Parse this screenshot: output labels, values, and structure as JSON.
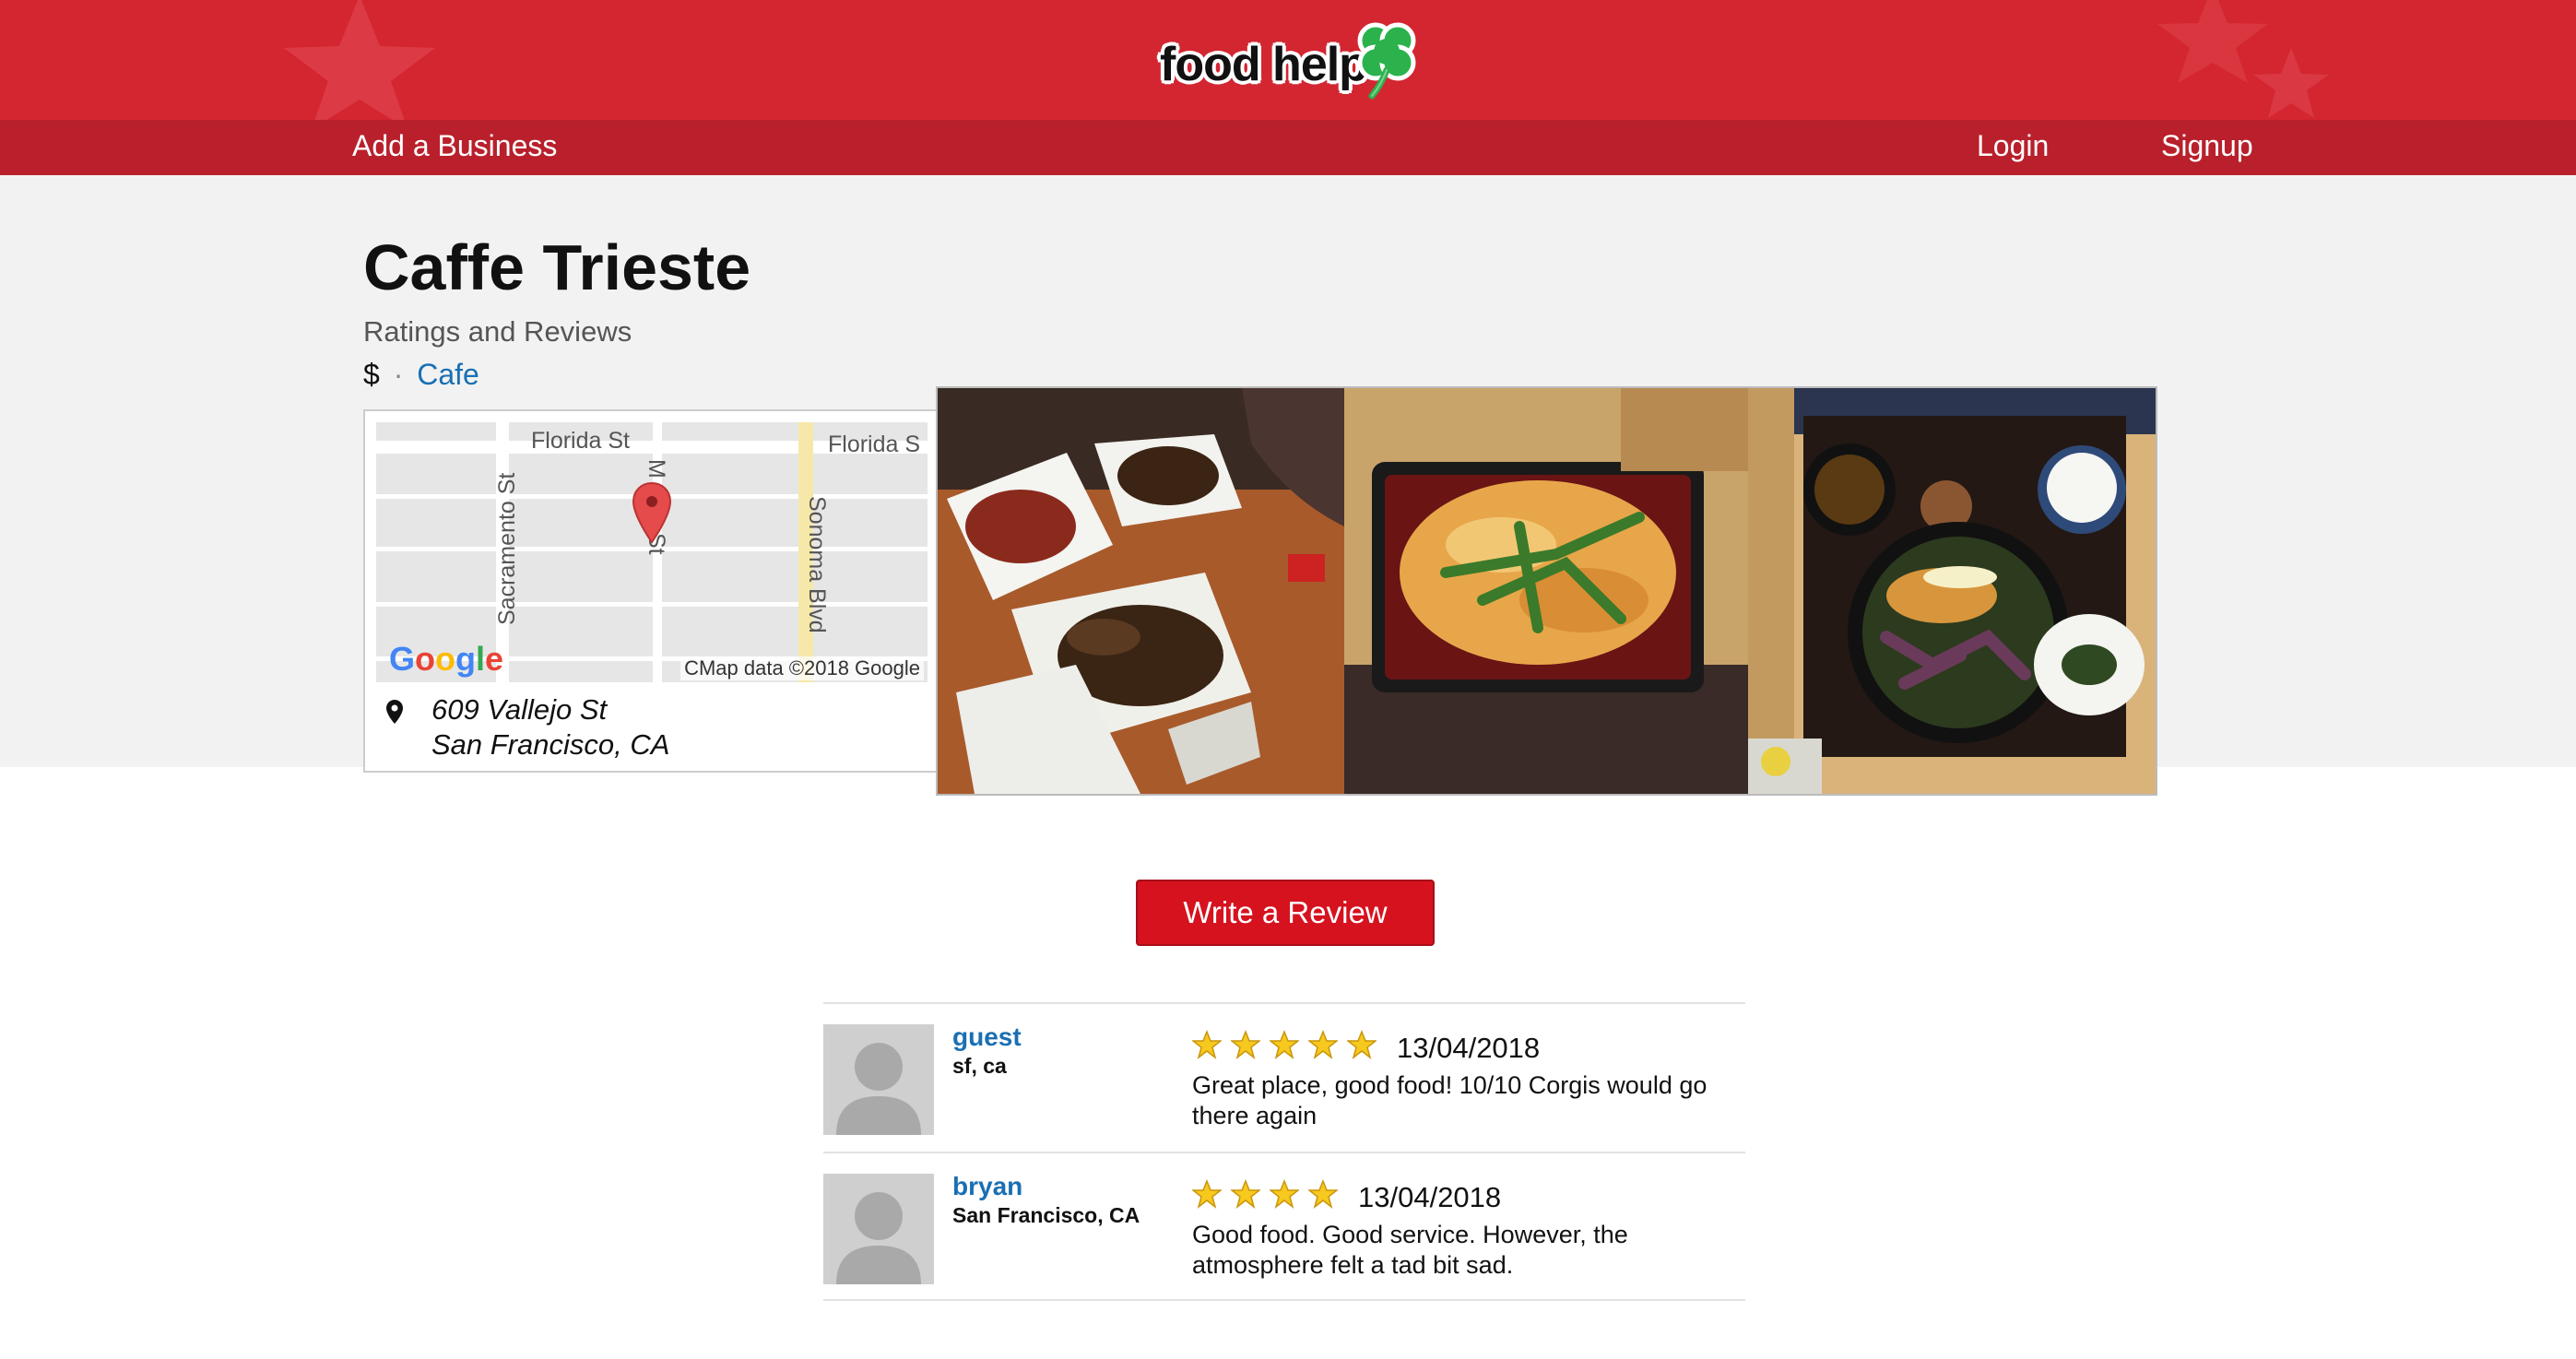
{
  "header": {
    "logo_text": "food help",
    "nav": {
      "add_business": "Add a Business",
      "login": "Login",
      "signup": "Signup"
    }
  },
  "business": {
    "name": "Caffe Trieste",
    "subtitle": "Ratings and Reviews",
    "price": "$",
    "separator": "·",
    "category": "Cafe",
    "address_line1": "609 Vallejo St",
    "address_line2": "San Francisco, CA"
  },
  "map": {
    "streets": [
      "Florida St",
      "Florida S",
      "Sacramento St",
      "Sonoma Blvd",
      "M",
      "St"
    ],
    "google_label": "Google",
    "copyright": "CMap data ©2018 Google"
  },
  "write_review_label": "Write a Review",
  "reviews": [
    {
      "user": "guest",
      "location": "sf, ca",
      "rating": 5,
      "date": "13/04/2018",
      "text": "Great place, good food! 10/10 Corgis would go there again"
    },
    {
      "user": "bryan",
      "location": "San Francisco, CA",
      "rating": 4,
      "date": "13/04/2018",
      "text": "Good food. Good service. However, the atmosphere felt a tad bit sad."
    }
  ],
  "colors": {
    "brand_red": "#d32631",
    "nav_red": "#b9202b",
    "button_red": "#d6121f",
    "link_blue": "#1a6fb3"
  }
}
